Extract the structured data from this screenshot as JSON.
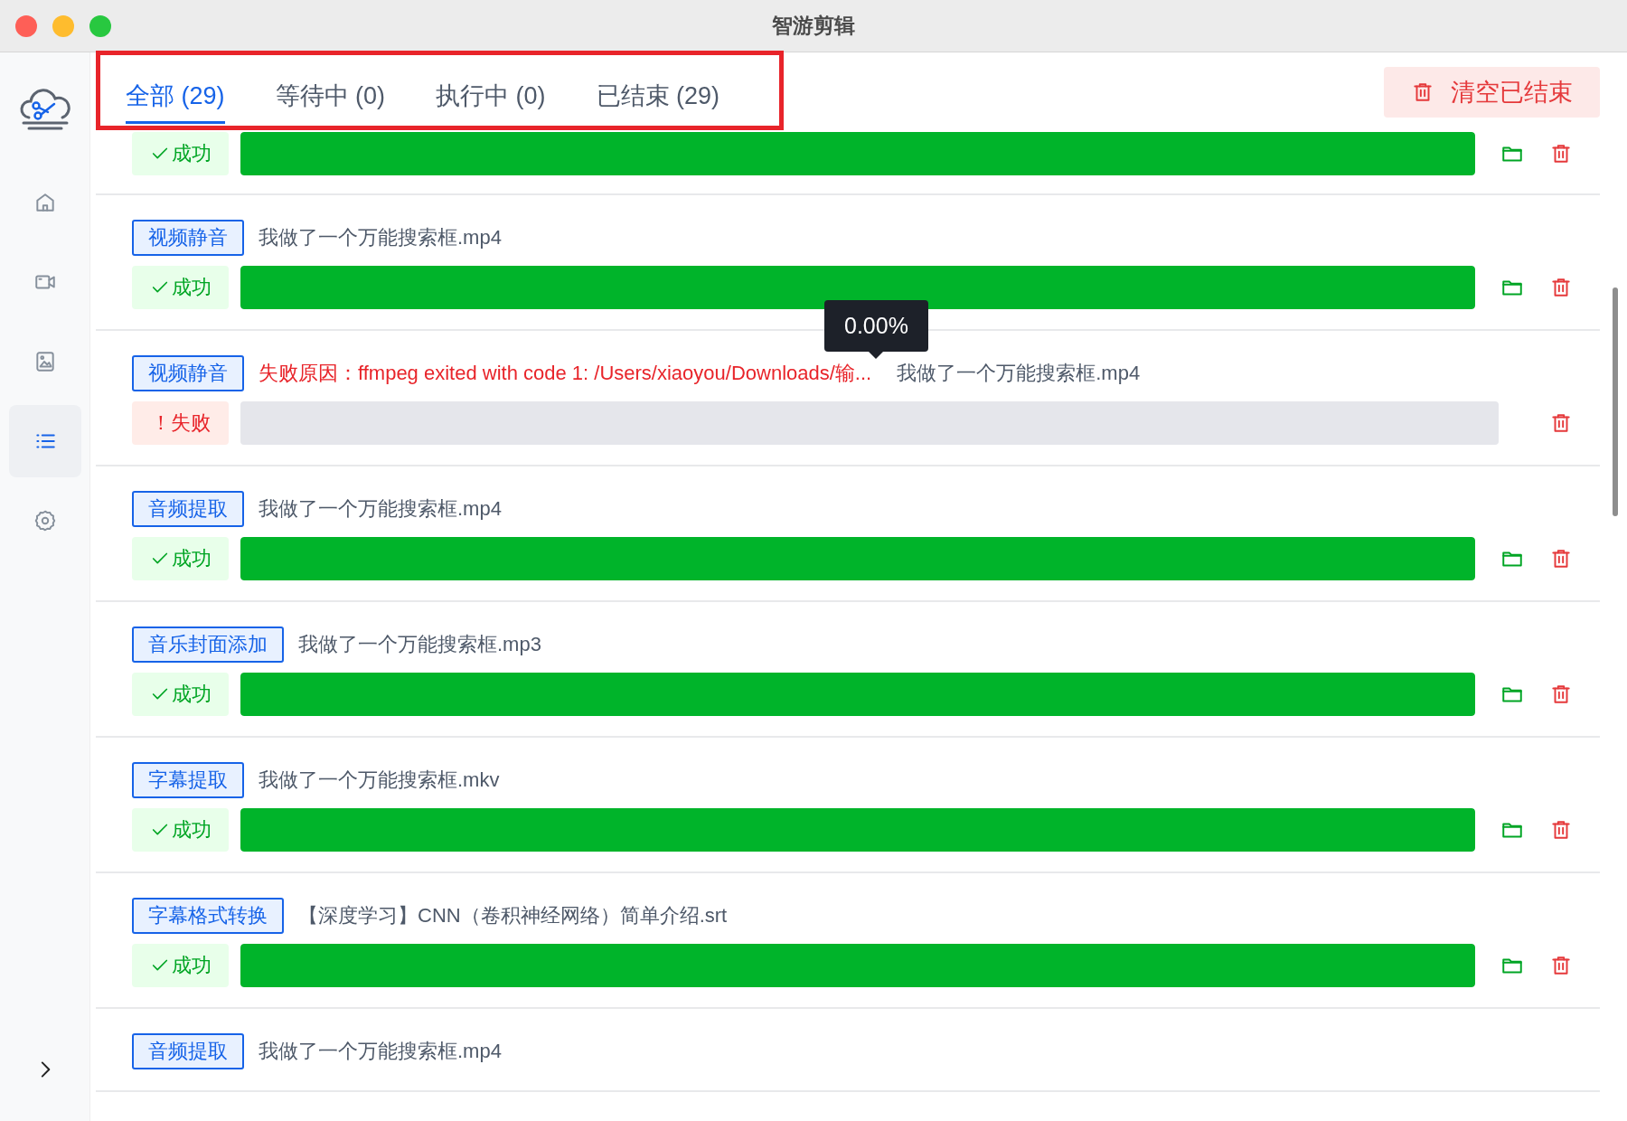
{
  "window": {
    "title": "智游剪辑"
  },
  "sidebar": {
    "items": [
      {
        "kind": "home",
        "selected": false
      },
      {
        "kind": "video",
        "selected": false
      },
      {
        "kind": "image",
        "selected": false
      },
      {
        "kind": "list",
        "selected": true
      },
      {
        "kind": "settings",
        "selected": false
      }
    ]
  },
  "tabs": [
    {
      "label": "全部 (29)",
      "selected": true
    },
    {
      "label": "等待中 (0)",
      "selected": false
    },
    {
      "label": "执行中 (0)",
      "selected": false
    },
    {
      "label": "已结束 (29)",
      "selected": false
    }
  ],
  "clear_button": {
    "label": "清空已结束"
  },
  "tasks": [
    {
      "status": {
        "kind": "success",
        "label": "成功"
      },
      "level": 1
    },
    {
      "tag": "视频静音",
      "name": "我做了一个万能搜索框.mp4",
      "status": {
        "kind": "success",
        "label": "成功"
      },
      "level": 1
    },
    {
      "tag": "视频静音",
      "error": "失败原因：ffmpeg exited with code 1: /Users/xiaoyou/Downloads/输...",
      "name": "我做了一个万能搜索框.mp4",
      "status": {
        "kind": "fail",
        "label": "！失败"
      },
      "level": 0,
      "tooltip": "0.00%"
    },
    {
      "tag": "音频提取",
      "name": "我做了一个万能搜索框.mp4",
      "status": {
        "kind": "success",
        "label": "成功"
      },
      "level": 1
    },
    {
      "tag": "音乐封面添加",
      "name": "我做了一个万能搜索框.mp3",
      "status": {
        "kind": "success",
        "label": "成功"
      },
      "level": 1
    },
    {
      "tag": "字幕提取",
      "name": "我做了一个万能搜索框.mkv",
      "status": {
        "kind": "success",
        "label": "成功"
      },
      "level": 1
    },
    {
      "tag": "字幕格式转换",
      "name": "【深度学习】CNN（卷积神经网络）简单介绍.srt",
      "status": {
        "kind": "success",
        "label": "成功"
      },
      "level": 1
    },
    {
      "tag": "音频提取",
      "name": "我做了一个万能搜索框.mp4"
    }
  ]
}
